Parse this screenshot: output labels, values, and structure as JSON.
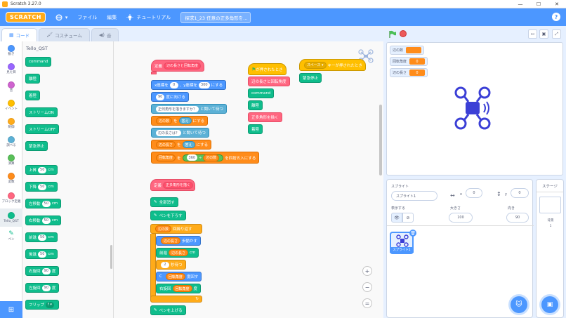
{
  "window": {
    "title": "Scratch 3.27.0",
    "min": "—",
    "max": "☐",
    "close": "✕"
  },
  "menu": {
    "logo": "SCRATCH",
    "file": "ファイル",
    "edit": "編集",
    "tutorials": "チュートリアル",
    "project_title": "探求1_23 任意の正多角形を…",
    "help": "?"
  },
  "tabs": {
    "code": "コード",
    "costumes": "コスチューム",
    "sounds": "音"
  },
  "categories": [
    {
      "label": "動き",
      "color": "#4c97ff"
    },
    {
      "label": "見た目",
      "color": "#9966ff"
    },
    {
      "label": "音",
      "color": "#cf63cf"
    },
    {
      "label": "イベント",
      "color": "#ffbf00"
    },
    {
      "label": "制御",
      "color": "#ffab19"
    },
    {
      "label": "調べる",
      "color": "#5cb1d6"
    },
    {
      "label": "演算",
      "color": "#59c059"
    },
    {
      "label": "変数",
      "color": "#ff8c1a"
    },
    {
      "label": "ブロック定義",
      "color": "#ff6680"
    },
    {
      "label": "Tello_QST",
      "color": "#0fbd8c"
    },
    {
      "label": "ペン",
      "color": "#0fbd8c"
    }
  ],
  "palette": {
    "title": "Tello_QST",
    "blocks": [
      {
        "label": "command"
      },
      {
        "label": "離陸"
      },
      {
        "label": "着陸"
      },
      {
        "label": "ストリームON"
      },
      {
        "label": "ストリームOFF"
      },
      {
        "label": "緊急停止"
      },
      {
        "label": "上昇",
        "value": "50",
        "unit": "cm"
      },
      {
        "label": "下降",
        "value": "50",
        "unit": "cm"
      },
      {
        "label": "左移動",
        "value": "50",
        "unit": "cm"
      },
      {
        "label": "右移動",
        "value": "50",
        "unit": "cm"
      },
      {
        "label": "前進",
        "value": "50",
        "unit": "cm"
      },
      {
        "label": "後進",
        "value": "50",
        "unit": "cm"
      },
      {
        "label": "右旋回",
        "value": "90",
        "unit": "度"
      },
      {
        "label": "左旋回",
        "value": "90",
        "unit": "度"
      },
      {
        "label": "フリップ",
        "value": "f ▾"
      }
    ]
  },
  "script": {
    "def1": {
      "define": "定義",
      "name": "辺の長さと回転角度"
    },
    "b1": {
      "a": "x座標を",
      "v1": "0",
      "b": "、y座標を",
      "v2": "300",
      "c": "にする"
    },
    "b2": {
      "v": "90",
      "a": "度に向ける"
    },
    "b3": {
      "q": "正何角形を描きますか？",
      "a": "と聞いて待つ"
    },
    "b4": {
      "var": "辺の数",
      "a": "を",
      "v": "答え",
      "b": "にする"
    },
    "b5": {
      "q": "辺の長さは？",
      "a": "と聞いて待つ"
    },
    "b6": {
      "var": "辺の長さ",
      "a": "を",
      "v": "答え",
      "b": "にする"
    },
    "b7": {
      "var": "回転角度",
      "a": "を",
      "v1": "360",
      "op": "÷",
      "v2": "辺の数",
      "b": "を四捨五入",
      "c": "にする"
    },
    "flag": {
      "a": "が押されたとき"
    },
    "s1": "辺の長さと回転角度",
    "s2": "command",
    "s3": "離陸",
    "s4": "正多角形を描く",
    "s5": "着陸",
    "key": {
      "k": "スペース ▾",
      "a": "キーが押されたとき"
    },
    "k1": "緊急停止",
    "def2": {
      "define": "定義",
      "name": "正多角形を描く"
    },
    "p1": "全部消す",
    "p2": "ペンを下ろす",
    "r1": {
      "v": "辺の数",
      "a": "回繰り返す"
    },
    "r2": {
      "v": "辺の長さ",
      "a": "歩動かす"
    },
    "r3": {
      "a": "前進",
      "v": "辺の長さ",
      "b": "cm"
    },
    "r4": {
      "v": "2",
      "a": "秒待つ"
    },
    "r5": {
      "a": "C",
      "v": "回転角度",
      "b": "度回す"
    },
    "r6": {
      "a": "右旋回",
      "v": "回転角度",
      "b": "度"
    },
    "p3": "ペンを上げる"
  },
  "zoom": {
    "in": "+",
    "out": "−",
    "reset": "="
  },
  "stage": {
    "monitors": [
      {
        "label": "辺の数",
        "value": ""
      },
      {
        "label": "回転角度",
        "value": "0"
      },
      {
        "label": "辺の長さ",
        "value": "0"
      }
    ]
  },
  "sprite": {
    "label_sprite": "スプライト",
    "name": "スプライト1",
    "x": "0",
    "y": "0",
    "show": "表示する",
    "size_label": "大きさ",
    "size": "100",
    "direction_label": "向き",
    "direction": "90",
    "thumb_name": "スプライト1"
  },
  "stage_pane": {
    "header": "ステージ",
    "bg_label": "背景",
    "bg_count": "1"
  },
  "colors": {
    "accent": "#4c97ff",
    "tello": "#0fbd8c"
  }
}
